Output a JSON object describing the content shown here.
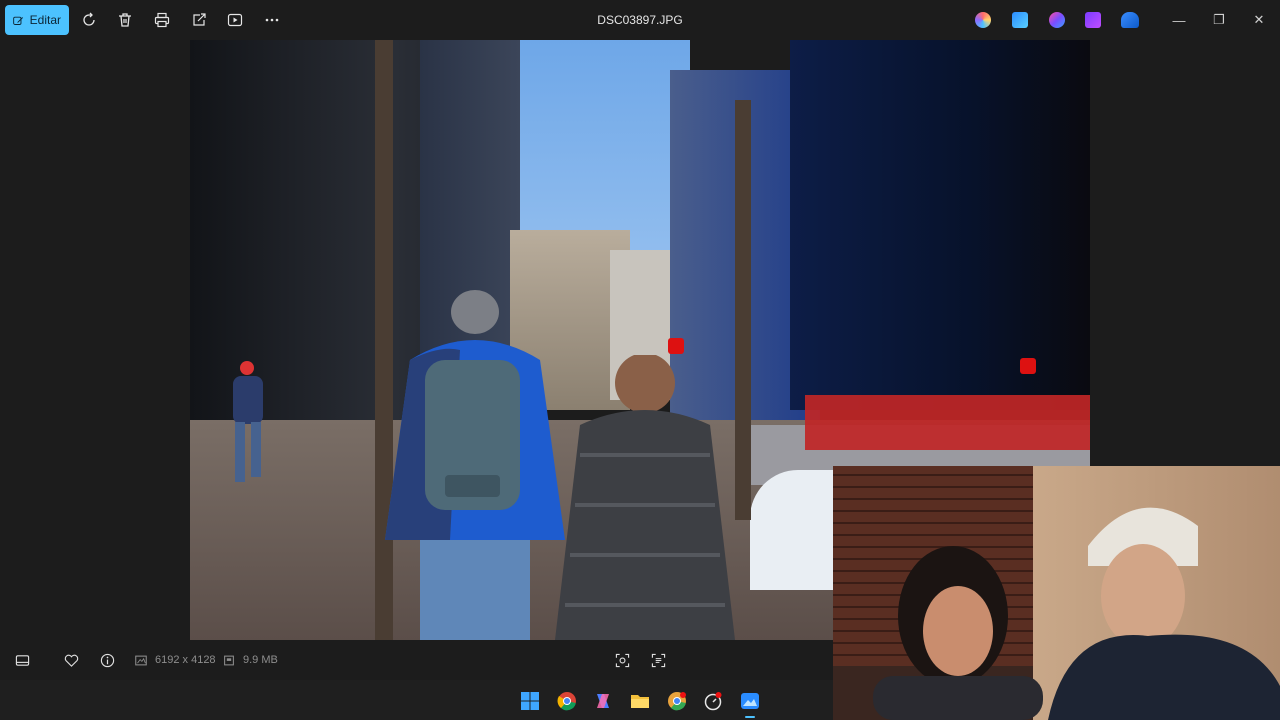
{
  "toolbar": {
    "edit_label": "Editar",
    "icons": [
      "rotate-icon",
      "delete-icon",
      "print-icon",
      "share-icon",
      "slideshow-icon",
      "more-icon"
    ]
  },
  "window": {
    "title": "DSC03897.JPG",
    "app_icons": [
      "copilot-icon",
      "photos-edit-icon",
      "designer-icon",
      "clipchamp-icon",
      "onedrive-icon"
    ],
    "controls": [
      "minimize-icon",
      "restore-icon",
      "close-icon"
    ]
  },
  "info_bar": {
    "dimensions": "6192 x 4128",
    "file_size": "9.9 MB"
  },
  "taskbar": {
    "apps": [
      "windows-start-icon",
      "chrome-icon",
      "copilot-icon",
      "file-explorer-icon",
      "chrome-canary-icon",
      "clock-app-icon",
      "photos-app-icon"
    ]
  },
  "colors": {
    "accent": "#4cc2ff",
    "background": "#1c1c1c"
  }
}
